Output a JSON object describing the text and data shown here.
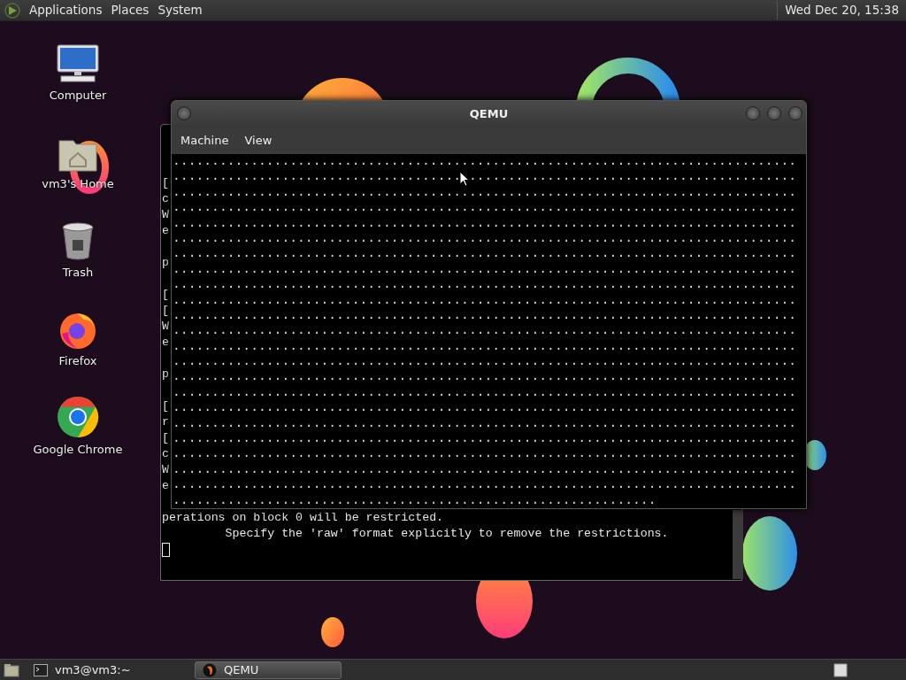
{
  "top_panel": {
    "menus": [
      {
        "label": "Applications"
      },
      {
        "label": "Places"
      },
      {
        "label": "System"
      }
    ],
    "clock": "Wed Dec 20, 15:38"
  },
  "desktop_icons": [
    {
      "label": "Computer",
      "kind": "computer"
    },
    {
      "label": "vm3's Home",
      "kind": "home"
    },
    {
      "label": "Trash",
      "kind": "trash"
    },
    {
      "label": "Firefox",
      "kind": "firefox"
    },
    {
      "label": "Google Chrome",
      "kind": "chrome"
    }
  ],
  "terminal_window": {
    "blocks": [
      [
        "[",
        "c",
        "W",
        "e"
      ],
      [
        "p"
      ],
      [
        "[",
        "[",
        "W",
        "e"
      ],
      [
        "p"
      ],
      [
        "[",
        "r",
        "[",
        "c",
        "W",
        "e"
      ],
      [
        "perations on block 0 will be restricted.",
        "         Specify the 'raw' format explicitly to remove the restrictions."
      ]
    ]
  },
  "qemu_window": {
    "title": "QEMU",
    "menu": [
      {
        "label": "Machine"
      },
      {
        "label": "View"
      }
    ],
    "screen_lines": [
      "................................................................................",
      [
        ".....................................",
        ".........................................."
      ],
      "................................................................................",
      "................................................................................",
      "................................................................................",
      "................................................................................",
      "................................................................................",
      "................................................................................",
      "................................................................................",
      "................................................................................",
      "................................................................................",
      "................................................................................",
      "................................................................................",
      "................................................................................",
      "................................................................................",
      "................................................................................",
      "................................................................................",
      "................................................................................",
      "................................................................................",
      "................................................................................",
      "................................................................................",
      "................................................................................",
      ".............................................................."
    ]
  },
  "taskbar": {
    "tasks": [
      {
        "label": "vm3@vm3:~",
        "kind": "terminal",
        "selected": false
      },
      {
        "label": "QEMU",
        "kind": "qemu",
        "selected": true
      }
    ]
  }
}
